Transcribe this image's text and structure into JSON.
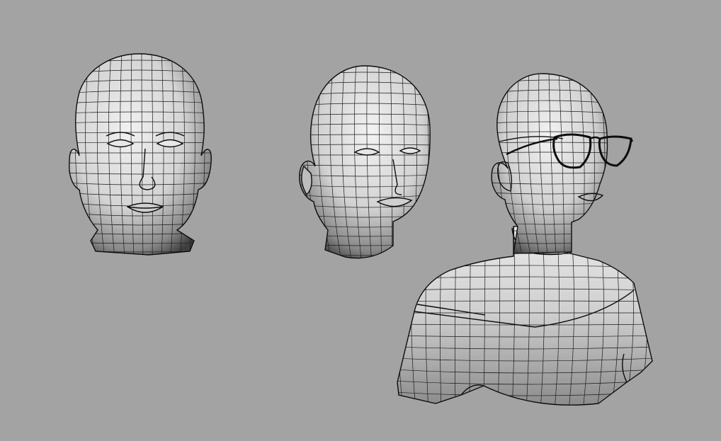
{
  "viewport": {
    "background": "#a3a3a3",
    "render_mode": "wireframe-on-shaded"
  },
  "models": [
    {
      "id": "head-front",
      "shading": {
        "light": "#efefef",
        "dark": "#4a4a4a",
        "wire": "#1b1b1b"
      }
    },
    {
      "id": "head-three-quarter",
      "shading": {
        "light": "#efefef",
        "dark": "#4a4a4a",
        "wire": "#1b1b1b"
      }
    },
    {
      "id": "bust-with-glasses",
      "shading": {
        "light": "#efefef",
        "dark": "#4a4a4a",
        "wire": "#1b1b1b"
      }
    }
  ]
}
